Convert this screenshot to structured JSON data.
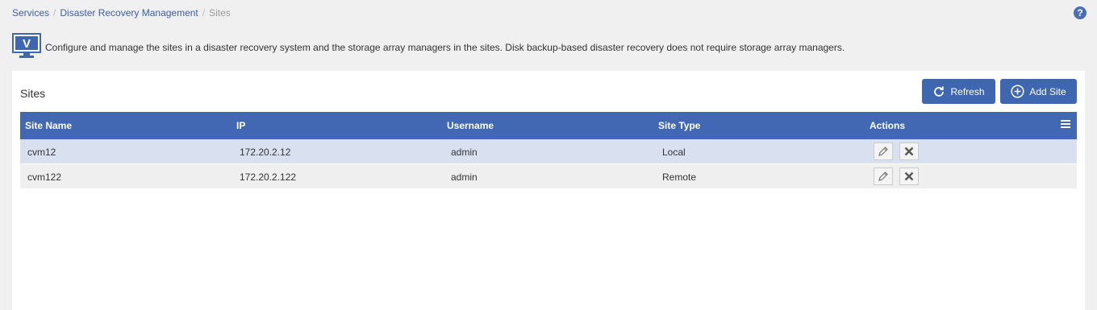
{
  "breadcrumb": {
    "items": [
      "Services",
      "Disaster Recovery Management"
    ],
    "current": "Sites",
    "separator": "/"
  },
  "help": {
    "icon": "question-icon",
    "label": "?"
  },
  "intro": {
    "logo_letter": "V",
    "text": "Configure and manage the sites in a disaster recovery system and the storage array managers in the sites. Disk backup-based disaster recovery does not require storage array managers."
  },
  "panel": {
    "title": "Sites",
    "refresh_label": "Refresh",
    "add_label": "Add Site"
  },
  "table": {
    "columns": [
      "Site Name",
      "IP",
      "Username",
      "Site Type",
      "Actions"
    ],
    "rows": [
      {
        "name": "cvm12",
        "ip": "172.20.2.12",
        "username": "admin",
        "type": "Local"
      },
      {
        "name": "cvm122",
        "ip": "172.20.2.122",
        "username": "admin",
        "type": "Remote"
      }
    ]
  },
  "colors": {
    "accent": "#3f66b1",
    "header": "#4368b3",
    "selected_row": "#d9e1f1",
    "link": "#3b5ea8"
  }
}
